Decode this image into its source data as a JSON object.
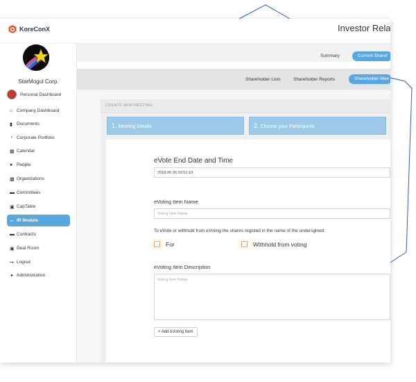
{
  "app": {
    "brand": "KoreConX",
    "page_title": "Investor Relat"
  },
  "sidebar": {
    "org_name": "StarMogul Corp.",
    "items": [
      {
        "label": "Personal Dashboard",
        "icon": "user-avatar-icon"
      },
      {
        "label": "Company Dashboard",
        "icon": "home-icon"
      },
      {
        "label": "Documents",
        "icon": "document-icon"
      },
      {
        "label": "Corporate Portfolio",
        "icon": "pie-chart-icon"
      },
      {
        "label": "Calendar",
        "icon": "calendar-icon"
      },
      {
        "label": "People",
        "icon": "people-icon"
      },
      {
        "label": "Organizations",
        "icon": "organizations-icon"
      },
      {
        "label": "Committees",
        "icon": "committees-icon"
      },
      {
        "label": "CapTable",
        "icon": "table-icon"
      },
      {
        "label": "IR Module",
        "icon": "handshake-icon",
        "active": true
      },
      {
        "label": "Contracts",
        "icon": "contract-icon"
      },
      {
        "label": "Deal Room",
        "icon": "deal-room-icon"
      },
      {
        "label": "Logout",
        "icon": "logout-icon"
      },
      {
        "label": "Administration",
        "icon": "wrench-icon"
      }
    ]
  },
  "tabs_primary": {
    "summary": "Summary",
    "current": "Current Sharef"
  },
  "tabs_secondary": {
    "lists": "Shareholder Lists",
    "reports": "Shareholder Reports",
    "meetings": "Shareholder Mee"
  },
  "meeting": {
    "header": "CREATE NEW MEETING",
    "steps": [
      {
        "num": "1.",
        "label": "Meeting Details"
      },
      {
        "num": "2.",
        "label": "Choose your Participants"
      }
    ],
    "end_date_label": "eVote End Date and Time",
    "end_date_value": "2018-06-30 09:51:10",
    "item_name_label": "eVoting Item Name",
    "item_name_placeholder": "Voting Item Name",
    "statement": "To eVote or withhold from eVoting the shares registed in the name of the undersgined:",
    "option_for": "For",
    "option_withhold": "Withhold from voting",
    "description_label": "eVoting Item Description",
    "description_placeholder": "Voting Item Notes",
    "add_button": "+ Add eVoting Item"
  },
  "colors": {
    "accent": "#5aa6de",
    "step": "#9ecaea",
    "checkbox": "#f0a05a",
    "decor_line": "#2f58c8"
  }
}
